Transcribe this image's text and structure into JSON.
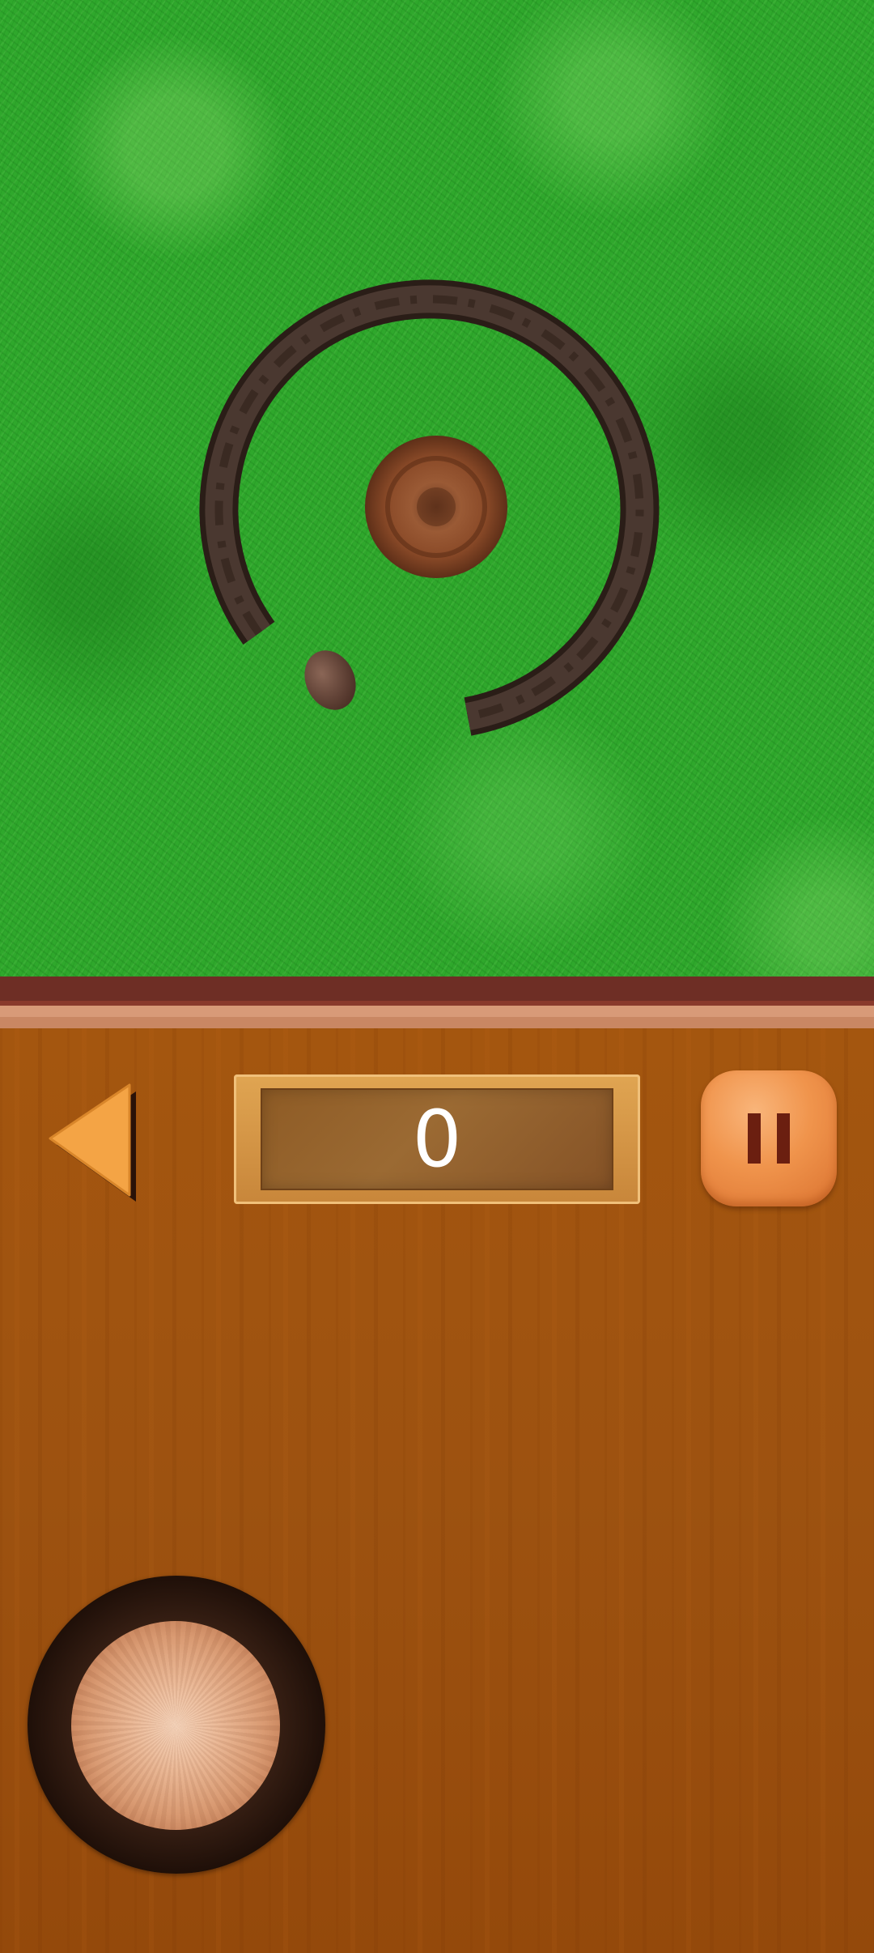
{
  "game": {
    "score": "0",
    "colors": {
      "grass": "#2fa82c",
      "wall": "#3a2a22",
      "ball": "#8a4a28",
      "rock": "#6e4a3c",
      "panel_wood": "#a4560f",
      "score_frame": "#e0a552",
      "button_orange": "#f0944c",
      "pause_bars": "#6b1f10"
    }
  },
  "icons": {
    "back": "left-triangle-icon",
    "pause": "pause-icon"
  }
}
